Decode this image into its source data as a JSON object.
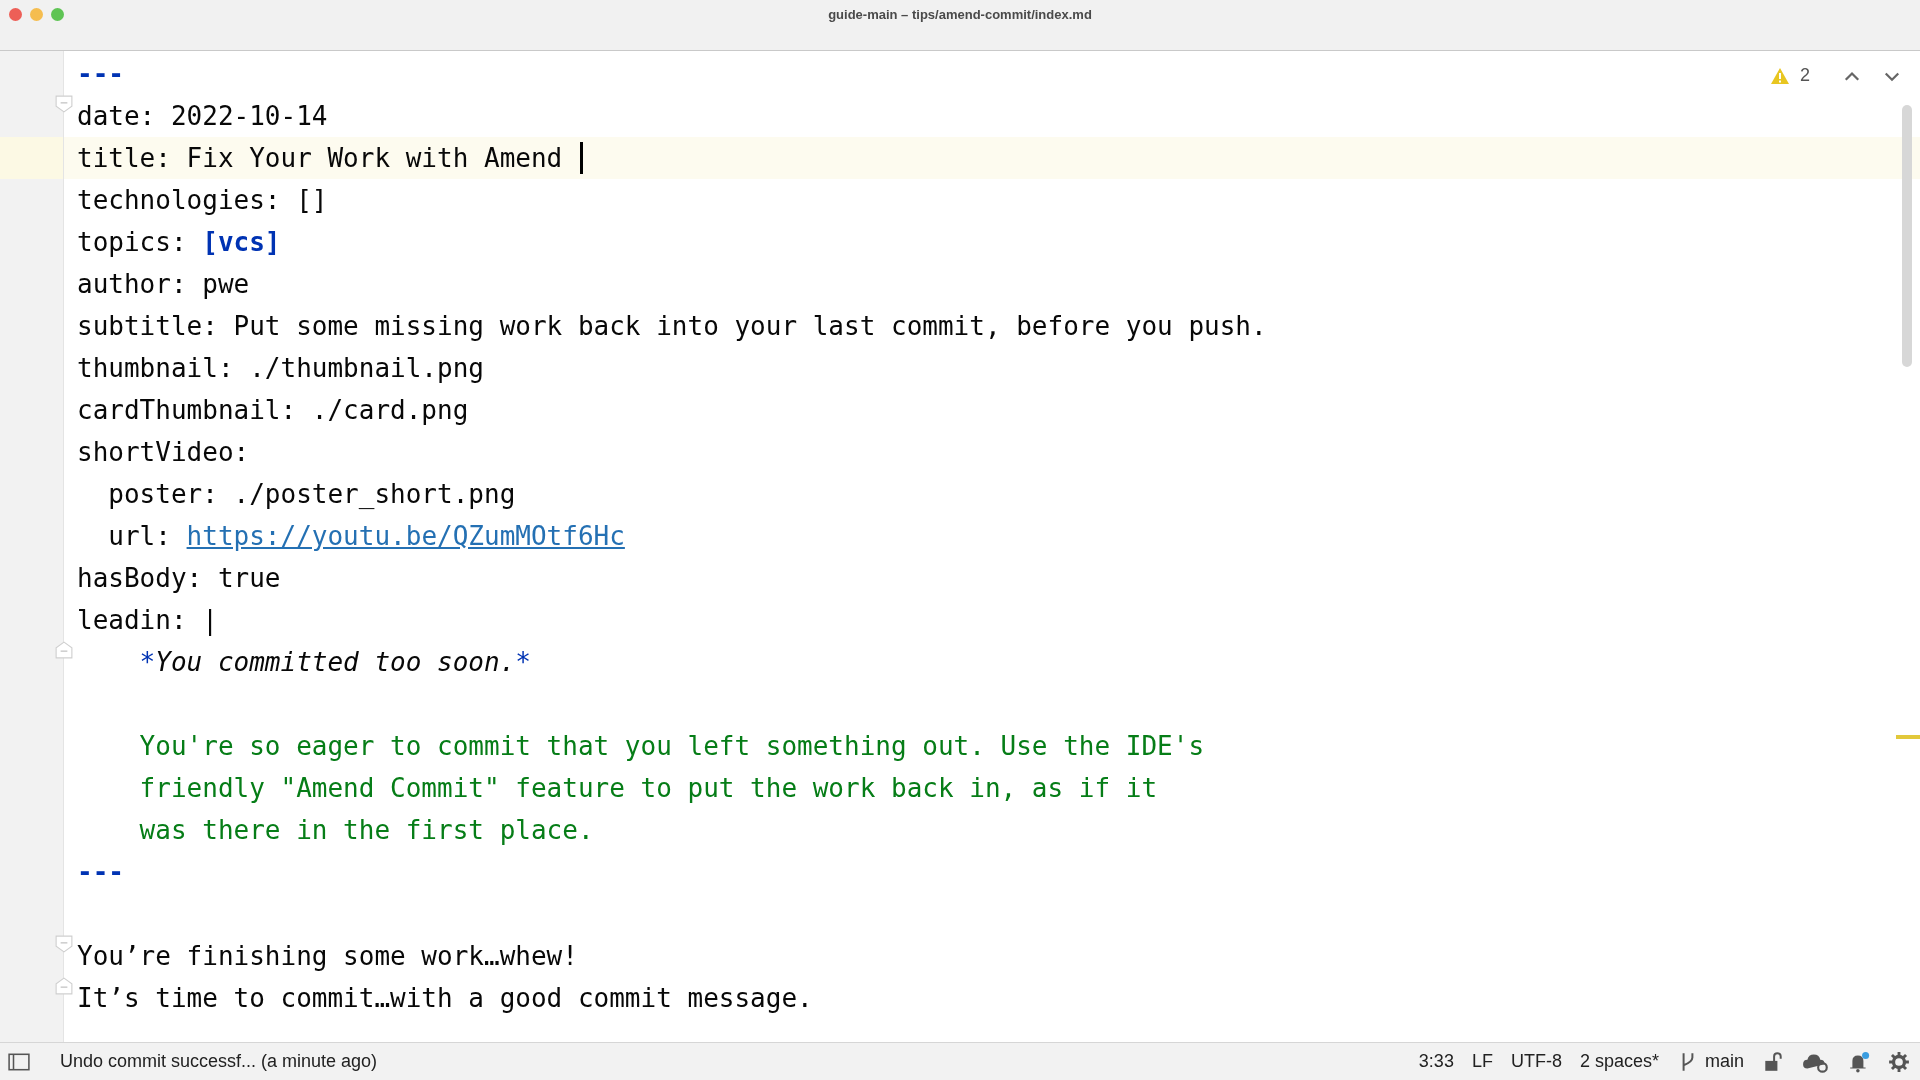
{
  "window": {
    "title": "guide-main – tips/amend-commit/index.md"
  },
  "inspections": {
    "warnings": "2"
  },
  "editor": {
    "lines": [
      {
        "current": false,
        "caret": false,
        "segments": [
          {
            "kind": "marker",
            "text": "---"
          }
        ]
      },
      {
        "fold_open": true,
        "current": false,
        "caret": false,
        "segments": [
          {
            "kind": "plain",
            "text": "date: 2022-10-14"
          }
        ]
      },
      {
        "current": true,
        "caret": true,
        "segments": [
          {
            "kind": "plain",
            "text": "title: Fix Your Work with Amend "
          }
        ]
      },
      {
        "current": false,
        "caret": false,
        "segments": [
          {
            "kind": "plain",
            "text": "technologies: []"
          }
        ]
      },
      {
        "current": false,
        "caret": false,
        "segments": [
          {
            "kind": "plain",
            "text": "topics: "
          },
          {
            "kind": "bracket",
            "text": "[vcs]"
          }
        ]
      },
      {
        "current": false,
        "caret": false,
        "segments": [
          {
            "kind": "plain",
            "text": "author: pwe"
          }
        ]
      },
      {
        "current": false,
        "caret": false,
        "segments": [
          {
            "kind": "plain",
            "text": "subtitle: Put some missing work back into your last commit, before you push."
          }
        ]
      },
      {
        "current": false,
        "caret": false,
        "segments": [
          {
            "kind": "plain",
            "text": "thumbnail: ./thumbnail.png"
          }
        ]
      },
      {
        "current": false,
        "caret": false,
        "segments": [
          {
            "kind": "plain",
            "text": "cardThumbnail: ./card.png"
          }
        ]
      },
      {
        "current": false,
        "caret": false,
        "segments": [
          {
            "kind": "plain",
            "text": "shortVideo:"
          }
        ]
      },
      {
        "current": false,
        "caret": false,
        "segments": [
          {
            "kind": "plain",
            "text": "  poster: ./poster_short.png"
          }
        ]
      },
      {
        "current": false,
        "caret": false,
        "segments": [
          {
            "kind": "plain",
            "text": "  url: "
          },
          {
            "kind": "link",
            "text": "https://youtu.be/QZumMOtf6Hc"
          }
        ]
      },
      {
        "current": false,
        "caret": false,
        "segments": [
          {
            "kind": "plain",
            "text": "hasBody: true"
          }
        ]
      },
      {
        "current": false,
        "caret": false,
        "segments": [
          {
            "kind": "plain",
            "text": "leadin: |"
          }
        ]
      },
      {
        "fold_close": true,
        "current": false,
        "caret": false,
        "segments": [
          {
            "kind": "emphasis-mark",
            "text": "    *"
          },
          {
            "kind": "italic",
            "text": "You committed too soon."
          },
          {
            "kind": "emphasis-mark",
            "text": "*"
          }
        ]
      },
      {
        "current": false,
        "caret": false
      },
      {
        "current": false,
        "caret": false,
        "segments": [
          {
            "kind": "string",
            "text": "    You're so eager to commit that you left something out. Use the IDE's"
          }
        ]
      },
      {
        "current": false,
        "caret": false,
        "segments": [
          {
            "kind": "string",
            "text": "    friendly \"Amend Commit\" feature to put the work back in, as if it"
          }
        ]
      },
      {
        "current": false,
        "caret": false,
        "segments": [
          {
            "kind": "string",
            "text": "    was there in the first place."
          }
        ]
      },
      {
        "current": false,
        "caret": false,
        "segments": [
          {
            "kind": "marker",
            "text": "---"
          }
        ]
      },
      {
        "current": false,
        "caret": false
      },
      {
        "fold_open": true,
        "current": false,
        "caret": false,
        "segments": [
          {
            "kind": "plain",
            "text": "You’re finishing some work…whew!"
          }
        ]
      },
      {
        "fold_close": true,
        "current": false,
        "caret": false,
        "segments": [
          {
            "kind": "plain",
            "text": "It’s time to commit…with a good commit message."
          }
        ]
      }
    ]
  },
  "status_bar": {
    "message": "Undo commit successf... (a minute ago)",
    "position": "3:33",
    "line_separator": "LF",
    "encoding": "UTF-8",
    "indent": "2 spaces*",
    "branch": "main",
    "notifications_unread": true
  }
}
